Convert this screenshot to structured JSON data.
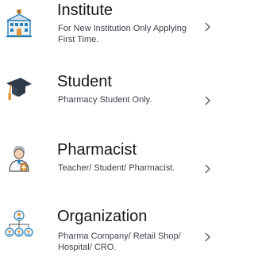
{
  "roles": [
    {
      "icon": "institute-building-icon",
      "title": "Institute",
      "description": "For New Institution Only Applying First Time."
    },
    {
      "icon": "graduation-cap-icon",
      "title": "Student",
      "description": "Pharmacy Student Only."
    },
    {
      "icon": "pharmacist-icon",
      "title": "Pharmacist",
      "description": "Teacher/ Student/ Pharmacist."
    },
    {
      "icon": "organization-network-icon",
      "title": "Organization",
      "description": "Pharma Company/ Retail Shop/ Hospital/ CRO."
    }
  ],
  "chevron_icon": "chevron-right-icon",
  "colors": {
    "title": "#15171c",
    "description": "#3b3f48",
    "chevron": "#555a63",
    "icon_blue": "#2c7fb8",
    "icon_orange": "#e0963a"
  }
}
